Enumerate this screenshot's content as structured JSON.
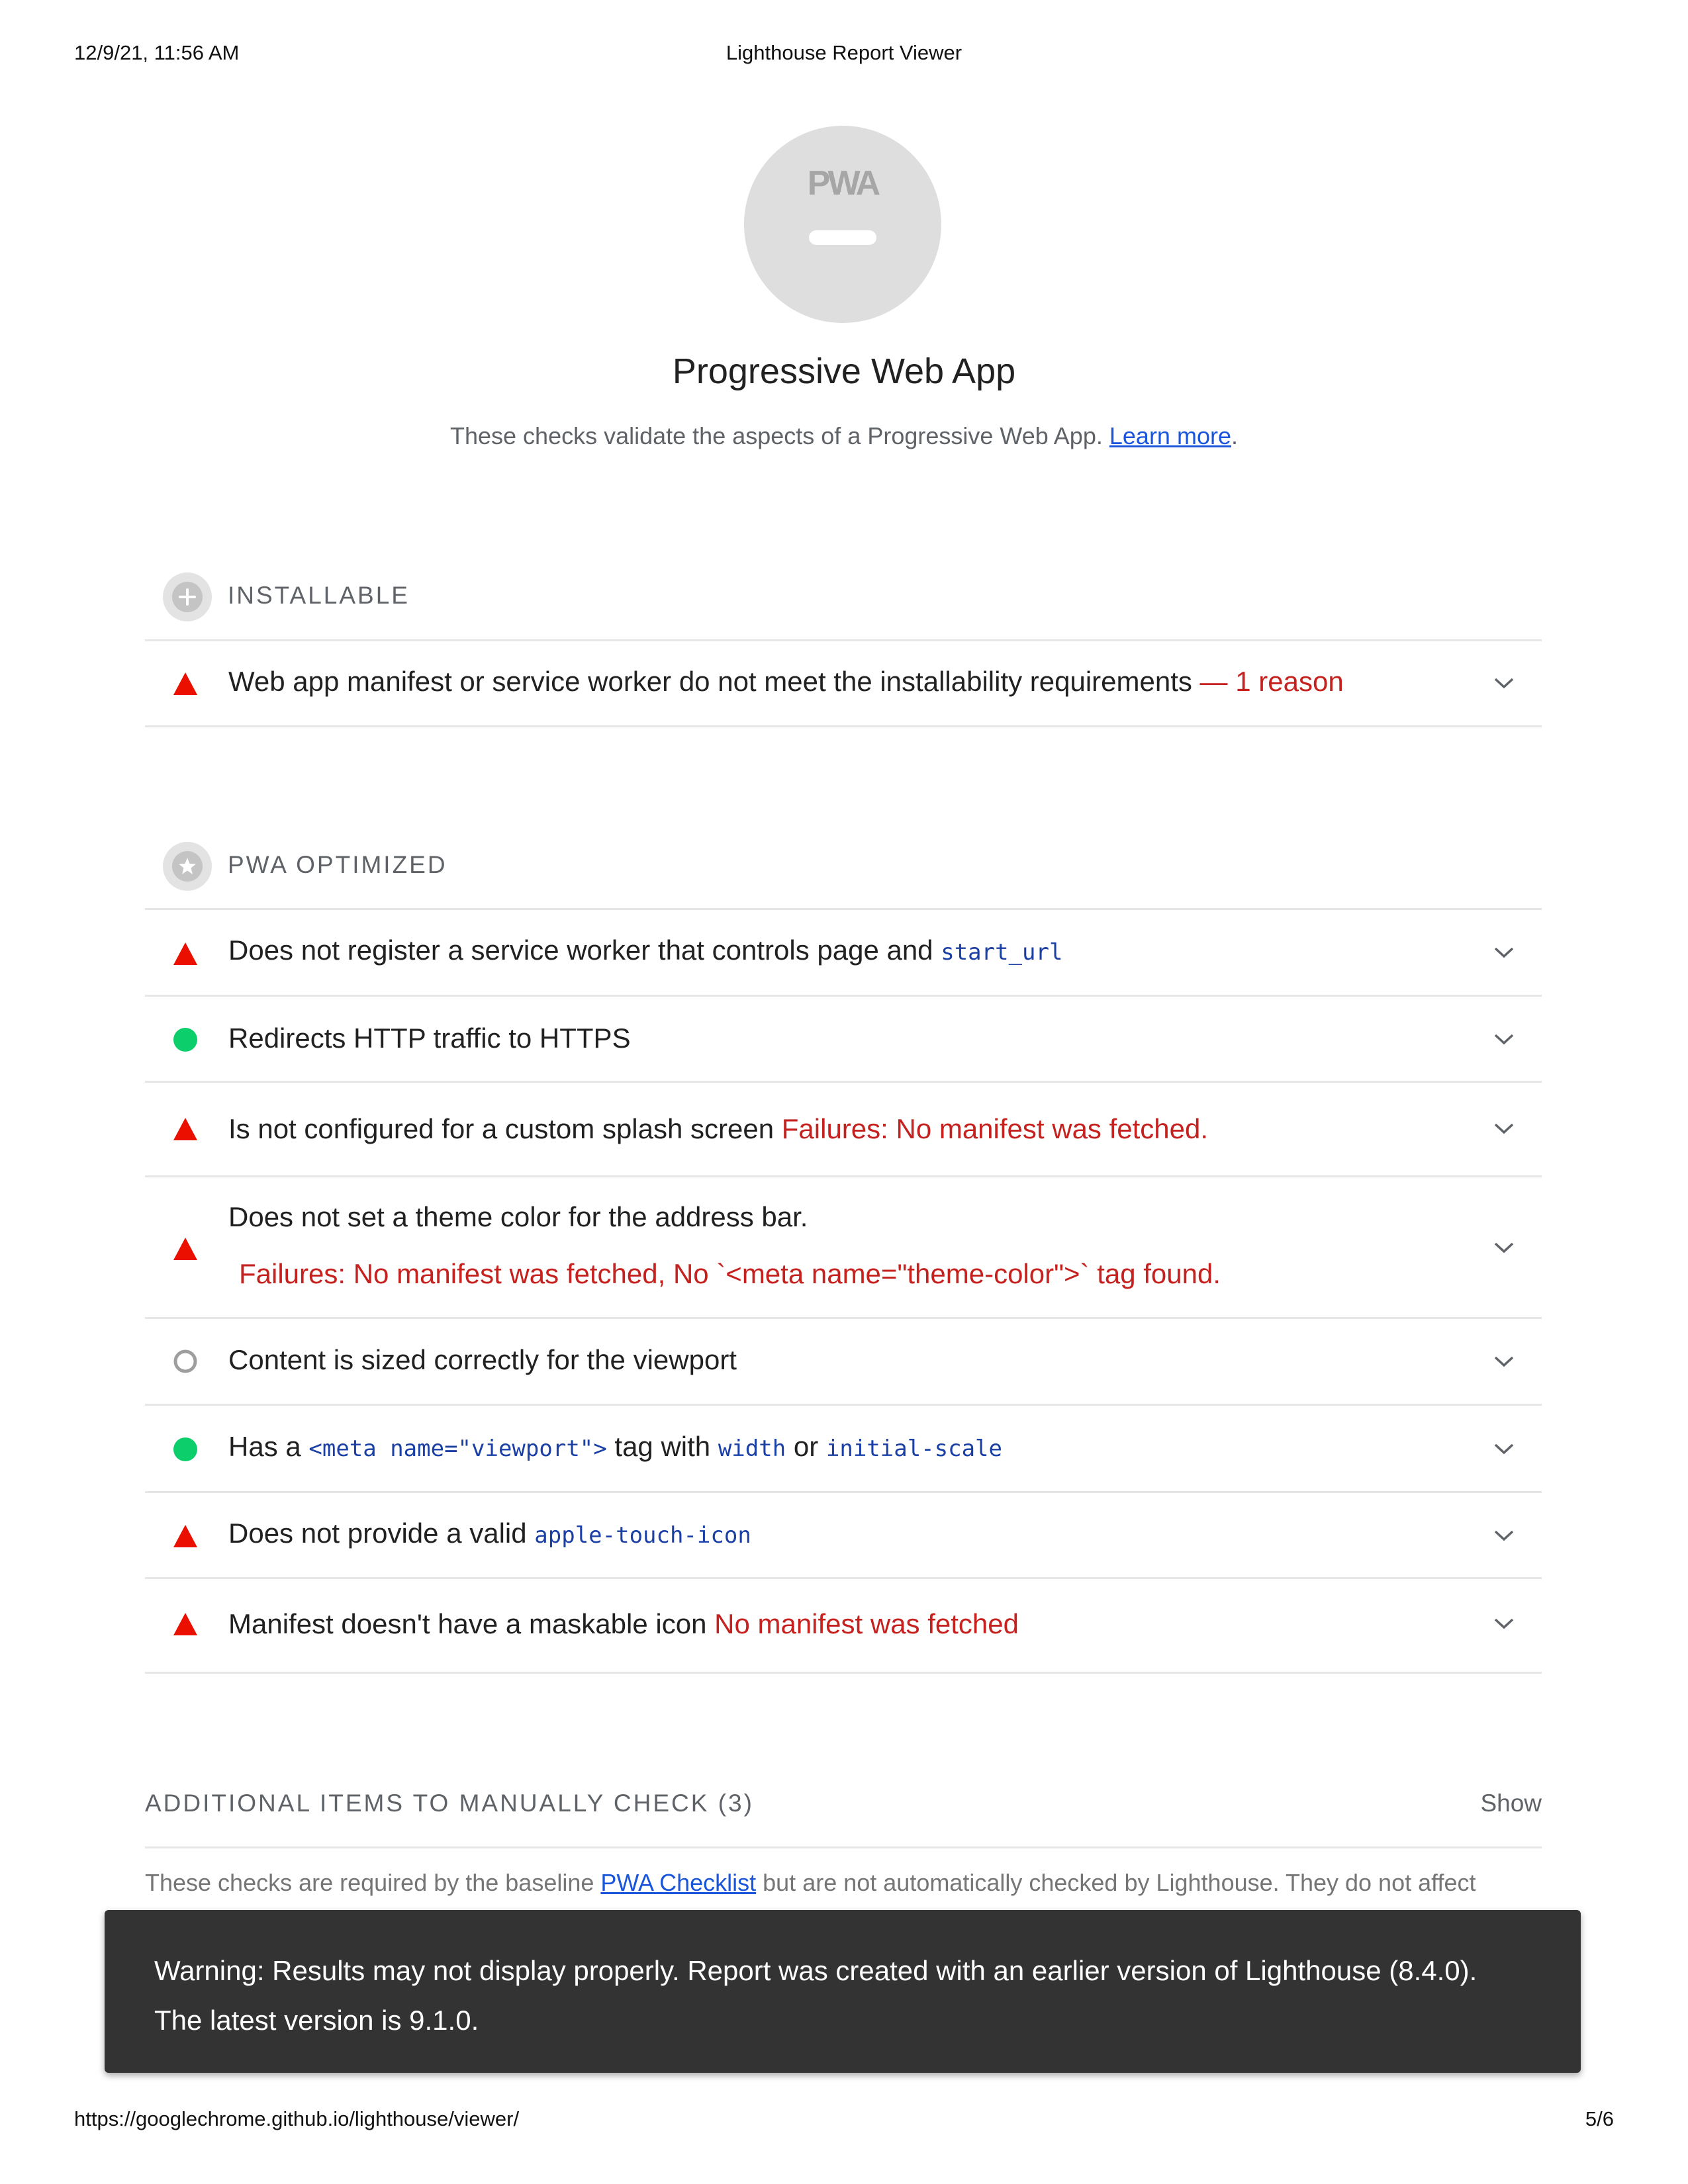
{
  "print": {
    "date": "12/9/21, 11:56 AM",
    "title": "Lighthouse Report Viewer",
    "url": "https://googlechrome.github.io/lighthouse/viewer/",
    "page": "5/6"
  },
  "category": {
    "logo_text": "PWA",
    "title": "Progressive Web App",
    "description": "These checks validate the aspects of a Progressive Web App.",
    "learn_more": "Learn more",
    "desc_end": "."
  },
  "groups": {
    "installable": {
      "title": "INSTALLABLE",
      "icon": "plus-icon"
    },
    "optimized": {
      "title": "PWA OPTIMIZED",
      "icon": "star-icon"
    }
  },
  "audits": {
    "installable": {
      "status": "fail",
      "title": "Web app manifest or service worker do not meet the installability requirements",
      "extra": " — 1 reason"
    },
    "service_worker": {
      "status": "fail",
      "title": "Does not register a service worker that controls page and ",
      "code": "start_url"
    },
    "https_redirect": {
      "status": "pass",
      "title": "Redirects HTTP traffic to HTTPS"
    },
    "splash_screen": {
      "status": "fail",
      "title": "Is not configured for a custom splash screen ",
      "failure": "Failures: No manifest was fetched."
    },
    "theme_color": {
      "status": "fail",
      "title": "Does not set a theme color for the address bar.",
      "failure": "Failures: No manifest was fetched, No `<meta name=\"theme-color\">` tag found."
    },
    "content_width": {
      "status": "na",
      "title": "Content is sized correctly for the viewport"
    },
    "viewport": {
      "status": "pass",
      "title_a": "Has a ",
      "code_a": "<meta name=\"viewport\">",
      "title_b": " tag with ",
      "code_b": "width",
      "title_c": " or ",
      "code_c": "initial-scale"
    },
    "apple_touch_icon": {
      "status": "fail",
      "title": "Does not provide a valid ",
      "code": "apple-touch-icon"
    },
    "maskable_icon": {
      "status": "fail",
      "title": "Manifest doesn't have a maskable icon ",
      "failure": "No manifest was fetched"
    }
  },
  "manual": {
    "title": "ADDITIONAL ITEMS TO MANUALLY CHECK (3)",
    "show": "Show",
    "desc_a": "These checks are required by the baseline ",
    "link": "PWA Checklist",
    "desc_b": " but are not automatically checked by Lighthouse. They do not affect"
  },
  "warning": {
    "text_line1": "Warning: Results may not display properly. Report was created with an earlier version of Lighthouse (8.4.0).",
    "text_line2": "The latest version is 9.1.0."
  },
  "colors": {
    "fail": "#eb0f00",
    "fail_text": "#c5221f",
    "pass": "#0cce6b",
    "na": "#9e9e9e",
    "code": "#1a3fa5",
    "link": "#1a56db"
  }
}
